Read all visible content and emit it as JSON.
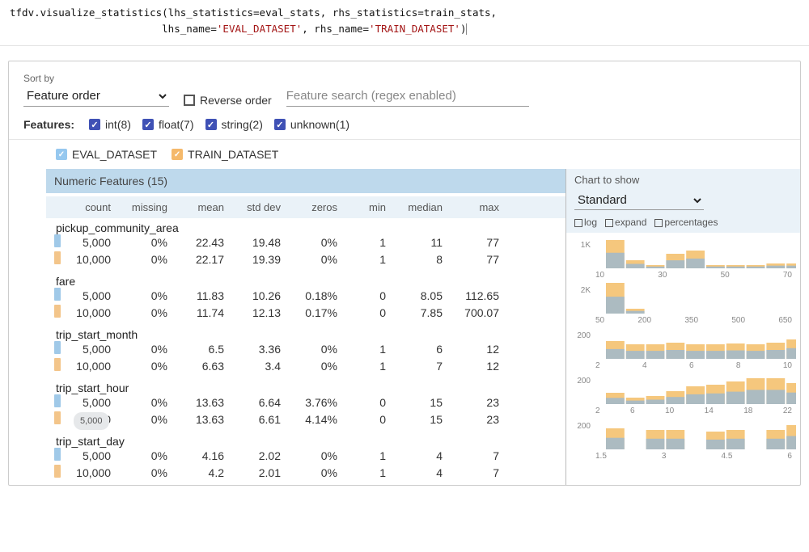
{
  "code": {
    "line1_a": "tfdv.visualize_statistics(lhs_statistics=eval_stats, rhs_statistics=train_stats,",
    "indent": "                         ",
    "lhs_name_k": "lhs_name=",
    "lhs_name_v": "'EVAL_DATASET'",
    "rhs_name_k": ", rhs_name=",
    "rhs_name_v": "'TRAIN_DATASET'",
    "close": ")"
  },
  "controls": {
    "sortby_label": "Sort by",
    "sortby_value": "Feature order",
    "reverse_label": "Reverse order",
    "search_placeholder": "Feature search (regex enabled)"
  },
  "features": {
    "label": "Features:",
    "items": [
      {
        "label": "int(8)"
      },
      {
        "label": "float(7)"
      },
      {
        "label": "string(2)"
      },
      {
        "label": "unknown(1)"
      }
    ]
  },
  "legend": {
    "eval": "EVAL_DATASET",
    "train": "TRAIN_DATASET"
  },
  "section_header": "Numeric Features (15)",
  "columns": [
    "count",
    "missing",
    "mean",
    "std dev",
    "zeros",
    "min",
    "median",
    "max"
  ],
  "right": {
    "label": "Chart to show",
    "selected": "Standard",
    "opt_log": "log",
    "opt_expand": "expand",
    "opt_pct": "percentages"
  },
  "tooltip_value": "5,000",
  "chart_data": [
    {
      "type": "table",
      "feature": "pickup_community_area",
      "columns": [
        "count",
        "missing",
        "mean",
        "std dev",
        "zeros",
        "min",
        "median",
        "max"
      ],
      "series": [
        {
          "name": "EVAL_DATASET",
          "values": [
            "5,000",
            "0%",
            "22.43",
            "19.48",
            "0%",
            "1",
            "11",
            "77"
          ]
        },
        {
          "name": "TRAIN_DATASET",
          "values": [
            "10,000",
            "0%",
            "22.17",
            "19.39",
            "0%",
            "1",
            "8",
            "77"
          ]
        }
      ],
      "histogram": {
        "ylim": "1K",
        "xticks": [
          "10",
          "30",
          "50",
          "70"
        ],
        "bars": [
          35,
          10,
          4,
          18,
          22,
          4,
          4,
          4,
          6,
          6
        ]
      }
    },
    {
      "type": "table",
      "feature": "fare",
      "columns": [
        "count",
        "missing",
        "mean",
        "std dev",
        "zeros",
        "min",
        "median",
        "max"
      ],
      "series": [
        {
          "name": "EVAL_DATASET",
          "values": [
            "5,000",
            "0%",
            "11.83",
            "10.26",
            "0.18%",
            "0",
            "8.05",
            "112.65"
          ]
        },
        {
          "name": "TRAIN_DATASET",
          "values": [
            "10,000",
            "0%",
            "11.74",
            "12.13",
            "0.17%",
            "0",
            "7.85",
            "700.07"
          ]
        }
      ],
      "histogram": {
        "ylim": "2K",
        "xticks": [
          "50",
          "200",
          "350",
          "500",
          "650"
        ],
        "bars": [
          38,
          6,
          0,
          0,
          0,
          0,
          0,
          0,
          0,
          0
        ]
      }
    },
    {
      "type": "table",
      "feature": "trip_start_month",
      "columns": [
        "count",
        "missing",
        "mean",
        "std dev",
        "zeros",
        "min",
        "median",
        "max"
      ],
      "series": [
        {
          "name": "EVAL_DATASET",
          "values": [
            "5,000",
            "0%",
            "6.5",
            "3.36",
            "0%",
            "1",
            "6",
            "12"
          ]
        },
        {
          "name": "TRAIN_DATASET",
          "values": [
            "10,000",
            "0%",
            "6.63",
            "3.4",
            "0%",
            "1",
            "7",
            "12"
          ]
        }
      ],
      "histogram": {
        "ylim": "200",
        "xticks": [
          "2",
          "4",
          "6",
          "8",
          "10"
        ],
        "bars": [
          22,
          18,
          18,
          20,
          18,
          18,
          19,
          18,
          20,
          24
        ]
      }
    },
    {
      "type": "table",
      "feature": "trip_start_hour",
      "columns": [
        "count",
        "missing",
        "mean",
        "std dev",
        "zeros",
        "min",
        "median",
        "max"
      ],
      "series": [
        {
          "name": "EVAL_DATASET",
          "values": [
            "5,000",
            "0%",
            "13.63",
            "6.64",
            "3.76%",
            "0",
            "15",
            "23"
          ]
        },
        {
          "name": "TRAIN_DATASET",
          "values": [
            "10,000",
            "0%",
            "13.63",
            "6.61",
            "4.14%",
            "0",
            "15",
            "23"
          ]
        }
      ],
      "histogram": {
        "ylim": "200",
        "xticks": [
          "2",
          "6",
          "10",
          "14",
          "18",
          "22"
        ],
        "bars": [
          14,
          8,
          10,
          16,
          22,
          24,
          28,
          32,
          32,
          26
        ]
      }
    },
    {
      "type": "table",
      "feature": "trip_start_day",
      "columns": [
        "count",
        "missing",
        "mean",
        "std dev",
        "zeros",
        "min",
        "median",
        "max"
      ],
      "series": [
        {
          "name": "EVAL_DATASET",
          "values": [
            "5,000",
            "0%",
            "4.16",
            "2.02",
            "0%",
            "1",
            "4",
            "7"
          ]
        },
        {
          "name": "TRAIN_DATASET",
          "values": [
            "10,000",
            "0%",
            "4.2",
            "2.01",
            "0%",
            "1",
            "4",
            "7"
          ]
        }
      ],
      "histogram": {
        "ylim": "200",
        "xticks": [
          "1.5",
          "3",
          "4.5",
          "6"
        ],
        "bars": [
          26,
          0,
          24,
          24,
          0,
          22,
          24,
          0,
          24,
          30
        ]
      }
    }
  ]
}
